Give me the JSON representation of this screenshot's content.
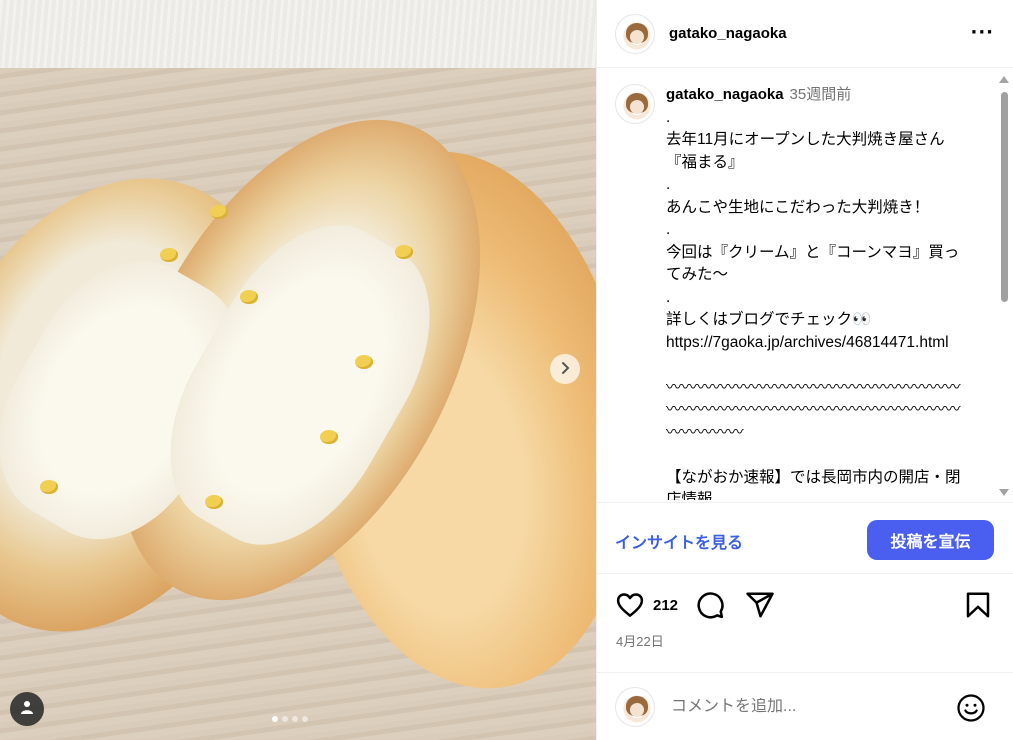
{
  "post": {
    "username": "gatako_nagaoka",
    "more_label": "···",
    "caption": {
      "username": "gatako_nagaoka",
      "time": "35週間前",
      "text": ".\n去年11月にオープンした大判焼き屋さん『福まる』\n.\nあんこや生地にこだわった大判焼き！\n.\n今回は『クリーム』と『コーンマヨ』買ってみた〜\n.\n詳しくはブログでチェック👀\nhttps://7gaoka.jp/archives/46814471.html\n\n〰〰〰〰〰〰〰〰〰〰〰〰〰〰〰〰〰〰〰〰〰〰〰〰〰〰〰〰〰〰〰〰〰〰〰〰〰〰〰〰〰〰〰\n\n【ながおか速報】では長岡市内の開店・閉店情報"
    },
    "insight_label": "インサイトを見る",
    "promote_label": "投稿を宣伝",
    "likes": "212",
    "date": "4月22日",
    "comment_placeholder": "コメントを追加..."
  },
  "carousel": {
    "current": 1,
    "total": 4
  },
  "icons": [
    "heart-icon",
    "comment-icon",
    "share-icon",
    "bookmark-icon",
    "emoji-icon",
    "user-tag-icon",
    "chevron-right-icon"
  ],
  "colors": {
    "accent": "#4a5ff0",
    "link": "#3b5fe0",
    "muted": "#737373"
  }
}
